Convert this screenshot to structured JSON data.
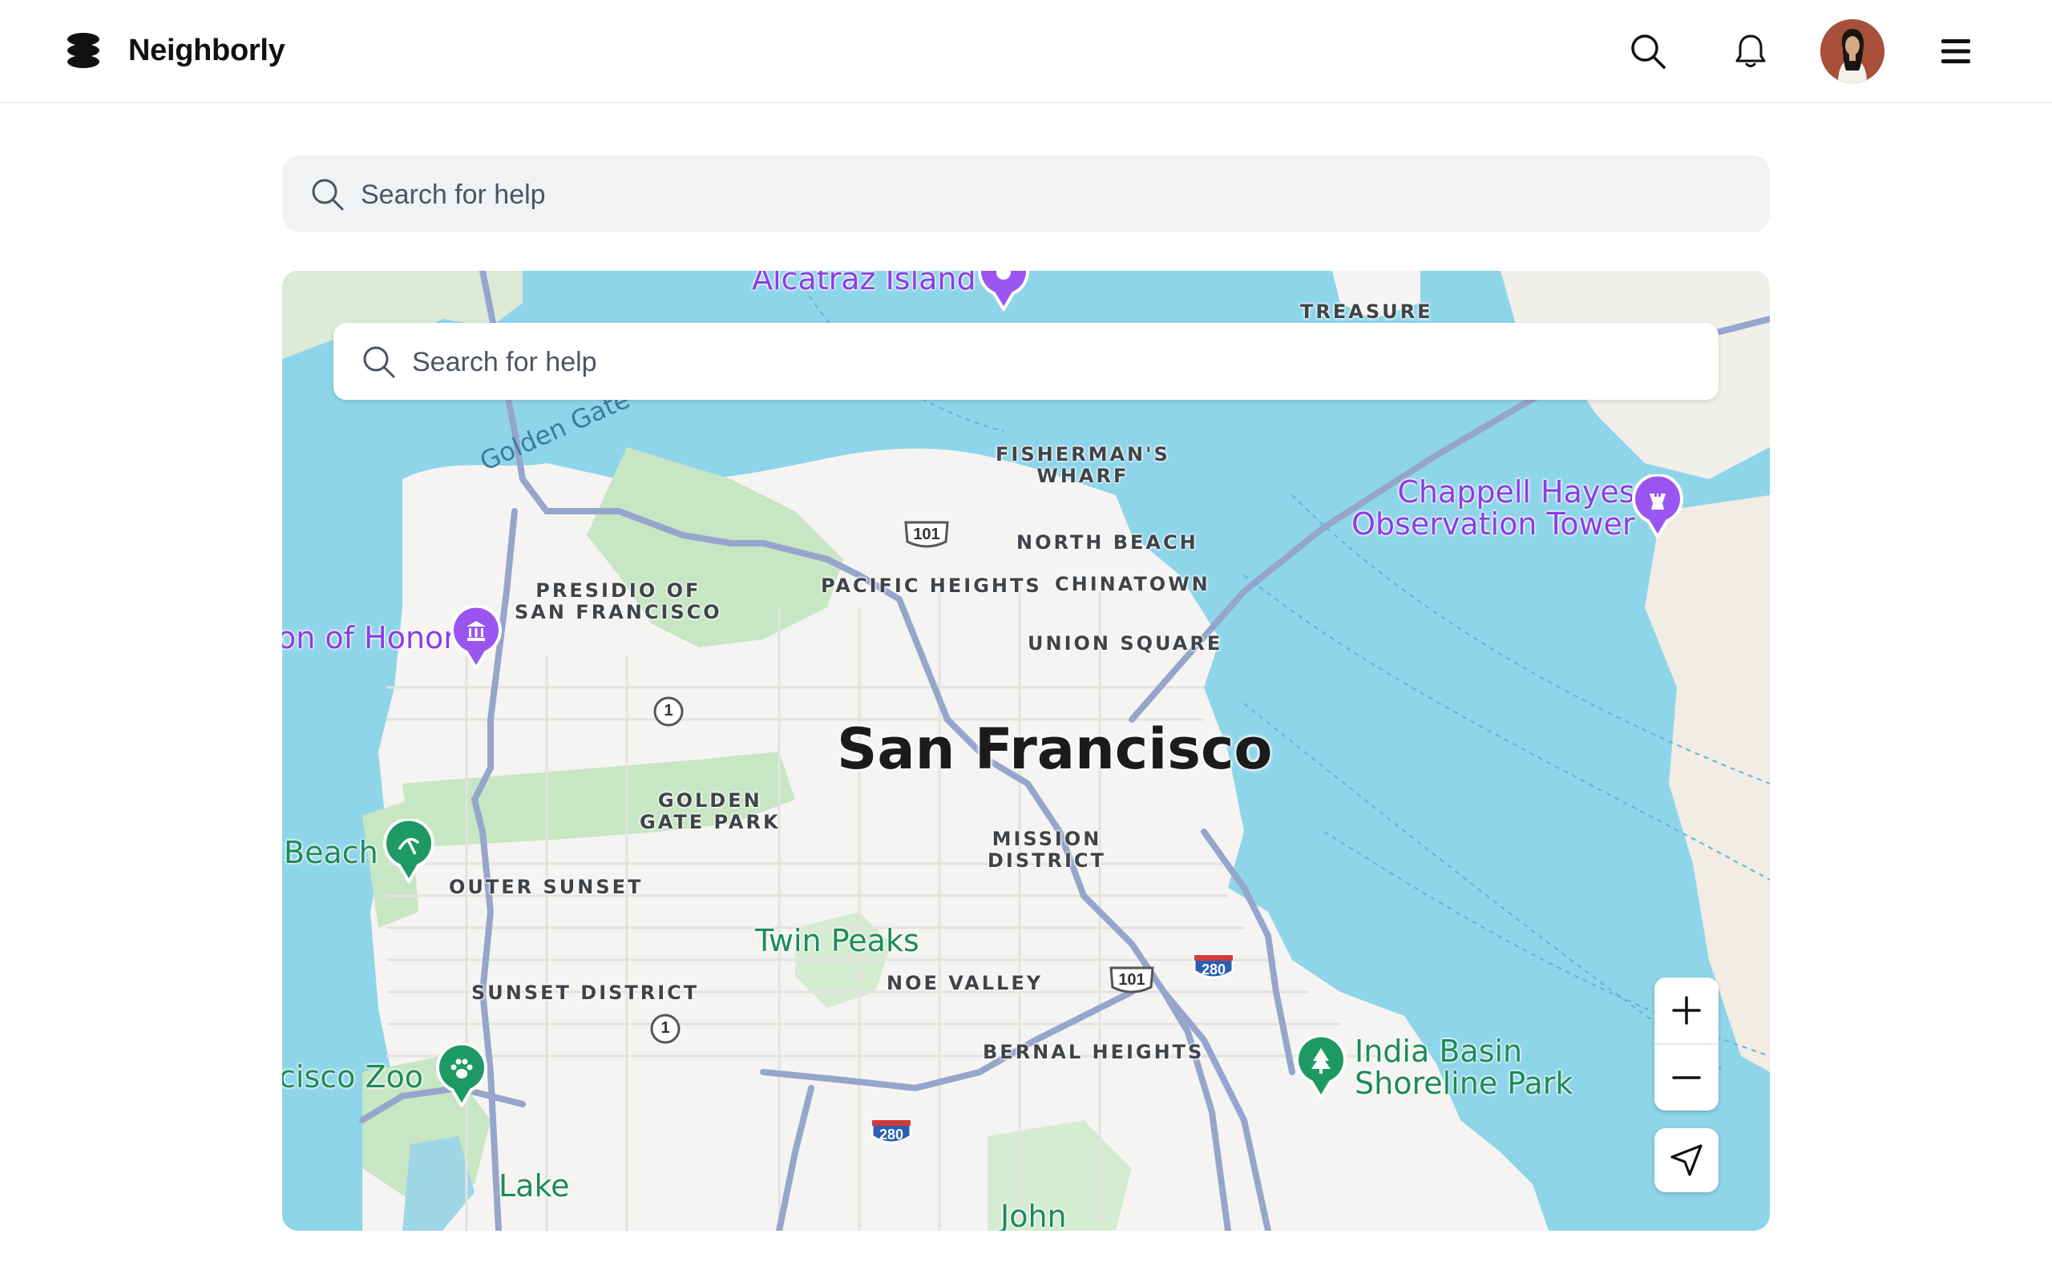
{
  "header": {
    "brand": "Neighborly",
    "icons": [
      "logo-icon",
      "search-icon",
      "bell-icon",
      "avatar",
      "menu-icon"
    ]
  },
  "page_search": {
    "placeholder": "Search for help"
  },
  "map": {
    "search": {
      "placeholder": "Search for help"
    },
    "city_label": "San Francisco",
    "areas": {
      "fishermans_wharf": "FISHERMAN'S\nWHARF",
      "north_beach": "NORTH BEACH",
      "pacific_heights": "PACIFIC HEIGHTS",
      "chinatown": "CHINATOWN",
      "presidio": "PRESIDIO OF\nSAN FRANCISCO",
      "union_square": "UNION SQUARE",
      "golden_gate_park": "GOLDEN\nGATE PARK",
      "mission_district": "MISSION\nDISTRICT",
      "outer_sunset": "OUTER SUNSET",
      "noe_valley": "NOE VALLEY",
      "sunset_district": "SUNSET DISTRICT",
      "bernal_heights": "BERNAL HEIGHTS",
      "treasure": "TREASURE"
    },
    "pois": {
      "alcatraz": "Alcatraz Island",
      "chappell": "Chappell Hayes\nObservation Tower",
      "legion": "on of Honor",
      "beach": "Beach",
      "twin_peaks": "Twin Peaks",
      "zoo": "cisco Zoo",
      "india_basin": "India Basin\nShoreline Park",
      "lake": "Lake",
      "john": "John",
      "golden_gate": "Golden Gate"
    },
    "shields": {
      "us101_north": "101",
      "ca1_north": "1",
      "ca1_south": "1",
      "us101_south": "101",
      "i280_east": "280",
      "i280_south": "280"
    },
    "controls": {
      "zoom_in": "zoom-in-button",
      "zoom_out": "zoom-out-button",
      "locate": "locate-button"
    },
    "colors": {
      "water": "#8fd5ea",
      "land": "#f5f4f2",
      "park": "#c7e6c3",
      "highway": "#95a5cc",
      "poi_purple": "#9a55f0",
      "poi_green": "#1d9a63"
    }
  }
}
